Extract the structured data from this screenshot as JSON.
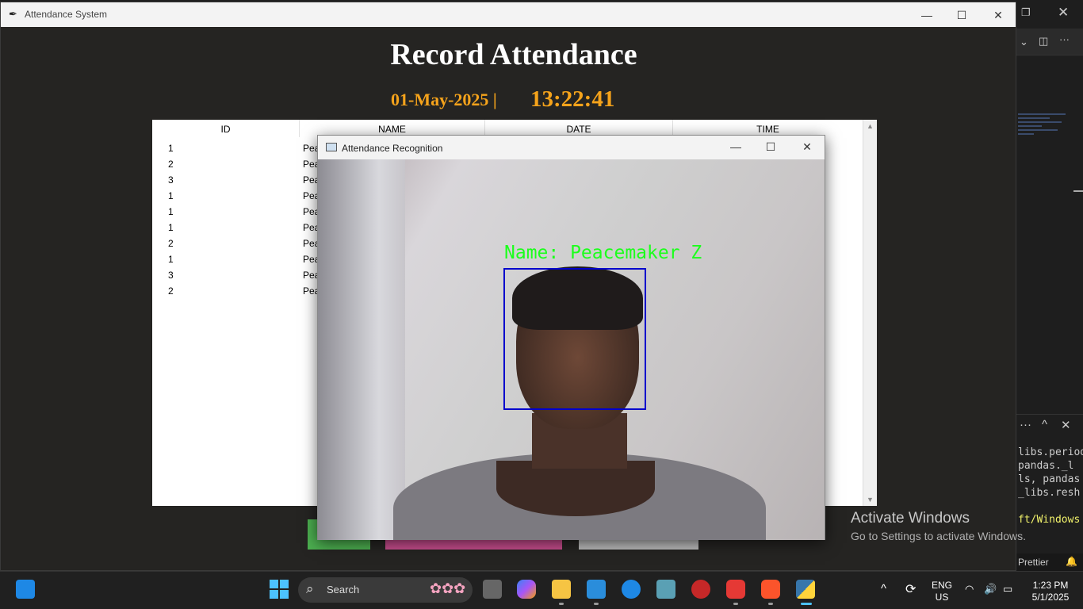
{
  "main_window": {
    "title": "Attendance System",
    "minimize": "—",
    "maximize": "☐",
    "close": "✕",
    "heading": "Record Attendance",
    "date": "01-May-2025  |",
    "time": "13:22:41",
    "table": {
      "columns": [
        "ID",
        "NAME",
        "DATE",
        "TIME"
      ],
      "rows": [
        {
          "id": "1",
          "name": "Pea"
        },
        {
          "id": "2",
          "name": "Pea"
        },
        {
          "id": "3",
          "name": "Pea"
        },
        {
          "id": "1",
          "name": "Pea"
        },
        {
          "id": "1",
          "name": "Pea"
        },
        {
          "id": "1",
          "name": "Pea"
        },
        {
          "id": "2",
          "name": "Pea"
        },
        {
          "id": "1",
          "name": "Pea"
        },
        {
          "id": "3",
          "name": "Pea"
        },
        {
          "id": "2",
          "name": "Pea"
        }
      ]
    },
    "colors": {
      "heading": "#ffffff",
      "clock": "#f5a31b",
      "button_green": "#4caf50",
      "button_pink": "#c74d8d",
      "button_gray": "#bdbdbd"
    }
  },
  "recognition_window": {
    "title": "Attendance Recognition",
    "minimize": "—",
    "maximize": "☐",
    "close": "✕",
    "overlay_label": "Name: Peacemaker Z",
    "colors": {
      "face_box": "#0000cc",
      "label": "#1cff1c"
    }
  },
  "activation": {
    "line1": "Activate Windows",
    "line2": "Go to Settings to activate Windows."
  },
  "background_editor": {
    "terminal_lines": [
      "libs.period",
      " pandas._l",
      "ls, pandas",
      "_libs.resh",
      "ft/Windows"
    ],
    "status_prettier": "Prettier",
    "panel_more": "···",
    "panel_up": "^",
    "panel_close": "✕"
  },
  "taskbar": {
    "search_label": "Search",
    "language_line1": "ENG",
    "language_line2": "US",
    "clock_time": "1:23 PM",
    "clock_date": "5/1/2025",
    "icons": [
      "start-icon",
      "windows-logo-icon",
      "task-view-icon",
      "copilot-icon",
      "file-explorer-icon",
      "vscode-icon",
      "app-blue-icon",
      "app-monitor-icon",
      "app-red-icon",
      "wps-icon",
      "brave-icon",
      "python-icon"
    ]
  }
}
